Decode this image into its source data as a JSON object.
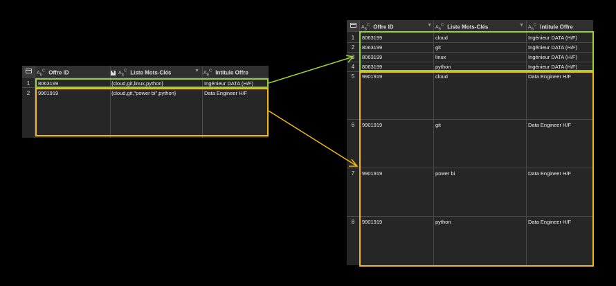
{
  "colors": {
    "background": "#000000",
    "grid": "#262626",
    "header": "#303030",
    "green_highlight": "#9bd22e",
    "yellow_highlight": "#f4b90d"
  },
  "icons": {
    "type_icon": "abc-text-type-icon",
    "table_icon": "table-icon",
    "dropdown": "chevron-down-icon",
    "filter": "filter-icon"
  },
  "left_table": {
    "type_label": "A",
    "type_sub": "B",
    "type_sup": "C",
    "columns": [
      "Offre ID",
      "Liste Mots-Clés",
      "Intitule Offre"
    ],
    "rows": [
      {
        "index": "1",
        "offre_id": "8063199",
        "mots_cles": "{cloud,git,linux,python}",
        "intitule": "Ingénieur DATA (H/F)"
      },
      {
        "index": "2",
        "offre_id": "9901919",
        "mots_cles": "{cloud,git,\"power bi\",python}",
        "intitule": "Data Engineer H/F"
      }
    ]
  },
  "right_table": {
    "columns": [
      "Offre ID",
      "Liste Mots-Clés",
      "Intitule Offre"
    ],
    "rows": [
      {
        "index": "1",
        "offre_id": "8063199",
        "mot_cle": "cloud",
        "intitule": "Ingénieur DATA (H/F)"
      },
      {
        "index": "2",
        "offre_id": "8063199",
        "mot_cle": "git",
        "intitule": "Ingénieur DATA (H/F)"
      },
      {
        "index": "3",
        "offre_id": "8063199",
        "mot_cle": "linux",
        "intitule": "Ingénieur DATA (H/F)"
      },
      {
        "index": "4",
        "offre_id": "8063199",
        "mot_cle": "python",
        "intitule": "Ingénieur DATA (H/F)"
      },
      {
        "index": "5",
        "offre_id": "9901919",
        "mot_cle": "cloud",
        "intitule": "Data Engineer H/F"
      },
      {
        "index": "6",
        "offre_id": "9901919",
        "mot_cle": "git",
        "intitule": "Data Engineer H/F"
      },
      {
        "index": "7",
        "offre_id": "9901919",
        "mot_cle": "power bi",
        "intitule": "Data Engineer H/F"
      },
      {
        "index": "8",
        "offre_id": "9901919",
        "mot_cle": "python",
        "intitule": "Data Engineer H/F"
      }
    ]
  }
}
